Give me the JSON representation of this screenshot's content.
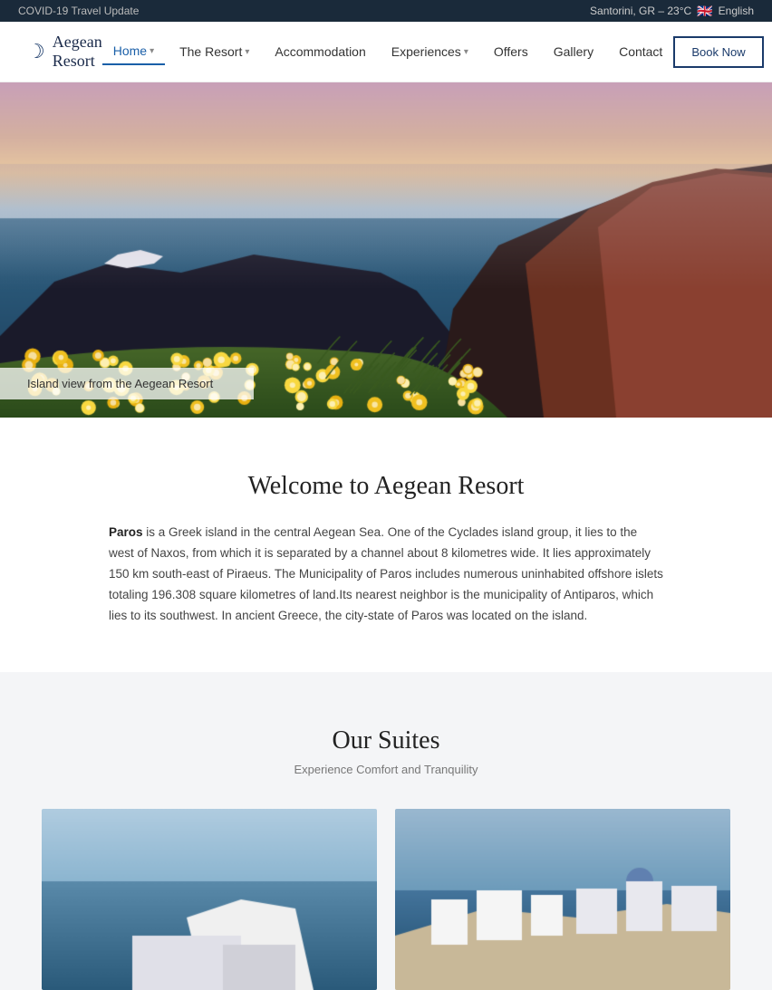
{
  "topbar": {
    "left": "COVID-19 Travel Update",
    "location": "Santorini, GR – 23°C",
    "flag": "🇬🇧",
    "language": "English"
  },
  "navbar": {
    "logo": "Aegean Resort",
    "links": [
      {
        "label": "Home",
        "active": true,
        "has_caret": true
      },
      {
        "label": "The Resort",
        "active": false,
        "has_caret": true
      },
      {
        "label": "Accommodation",
        "active": false,
        "has_caret": false
      },
      {
        "label": "Experiences",
        "active": false,
        "has_caret": true
      },
      {
        "label": "Offers",
        "active": false,
        "has_caret": false
      },
      {
        "label": "Gallery",
        "active": false,
        "has_caret": false
      },
      {
        "label": "Contact",
        "active": false,
        "has_caret": false
      }
    ],
    "book_now": "Book Now"
  },
  "hero": {
    "caption": "Island view from the Aegean Resort"
  },
  "welcome": {
    "title": "Welcome to Aegean Resort",
    "body": " is a Greek island in the central Aegean Sea. One of the Cyclades island group, it lies to the west of Naxos, from which it is separated by a channel about 8 kilometres wide. It lies approximately 150 km south-east of Piraeus. The Municipality of Paros includes numerous uninhabited offshore islets totaling 196.308 square kilometres of land.Its nearest neighbor is the municipality of Antiparos, which lies to its southwest. In ancient Greece, the city-state of Paros was located on the island.",
    "bold_word": "Paros"
  },
  "suites": {
    "title": "Our Suites",
    "subtitle": "Experience Comfort and Tranquility"
  },
  "colors": {
    "accent_blue": "#1a5fa8",
    "dark_navy": "#1a2a4a",
    "top_bar_bg": "#1a2a3a"
  }
}
